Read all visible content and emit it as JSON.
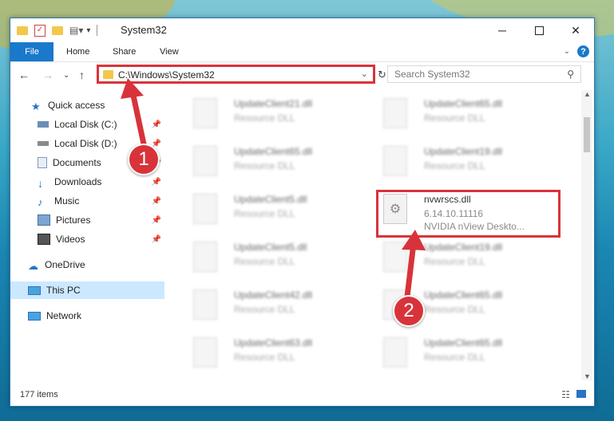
{
  "window": {
    "title": "System32",
    "controls": [
      "minimize-icon",
      "maximize-icon",
      "close-icon"
    ]
  },
  "ribbon": {
    "tabs": [
      "File",
      "Home",
      "Share",
      "View"
    ],
    "help": "?"
  },
  "navigation": {
    "address": "C:\\Windows\\System32",
    "search_placeholder": "Search System32"
  },
  "sidebar": {
    "items": [
      {
        "label": "Quick access",
        "icon": "star-icon"
      },
      {
        "label": "Local Disk (C:)",
        "icon": "drive-icon",
        "pinned": true
      },
      {
        "label": "Local Disk (D:)",
        "icon": "drive-icon",
        "pinned": true
      },
      {
        "label": "Documents",
        "icon": "documents-icon",
        "pinned": true
      },
      {
        "label": "Downloads",
        "icon": "download-icon",
        "pinned": true
      },
      {
        "label": "Music",
        "icon": "music-icon",
        "pinned": true
      },
      {
        "label": "Pictures",
        "icon": "pictures-icon",
        "pinned": true
      },
      {
        "label": "Videos",
        "icon": "videos-icon",
        "pinned": true
      },
      {
        "label": "OneDrive",
        "icon": "cloud-icon"
      },
      {
        "label": "This PC",
        "icon": "computer-icon",
        "selected": true
      },
      {
        "label": "Network",
        "icon": "network-icon"
      }
    ]
  },
  "files": {
    "left_column": [
      {
        "name": "UpdateClient21.dll",
        "type": "Resource DLL"
      },
      {
        "name": "UpdateClient65.dll",
        "type": "Resource DLL"
      },
      {
        "name": "UpdateClient5.dll",
        "type": "Resource DLL"
      },
      {
        "name": "UpdateClient5.dll",
        "type": "Resource DLL"
      },
      {
        "name": "UpdateClient42.dll",
        "type": "Resource DLL"
      },
      {
        "name": "UpdateClient63.dll",
        "type": "Resource DLL"
      }
    ],
    "right_column": [
      {
        "name": "UpdateClient65.dll",
        "type": "Resource DLL"
      },
      {
        "name": "UpdateClient19.dll",
        "type": "Resource DLL"
      },
      {
        "name": "nvwrscs.dll",
        "version": "6.14.10.11116",
        "description": "NVIDIA nView Deskto...",
        "highlighted": true
      },
      {
        "name": "UpdateClient19.dll",
        "type": "Resource DLL"
      },
      {
        "name": "UpdateClient65.dll",
        "type": "Resource DLL"
      },
      {
        "name": "UpdateClient65.dll",
        "type": "Resource DLL"
      }
    ]
  },
  "status": {
    "item_count": "177 items"
  },
  "annotations": {
    "badge1": "1",
    "badge2": "2",
    "color": "#d8333a"
  }
}
